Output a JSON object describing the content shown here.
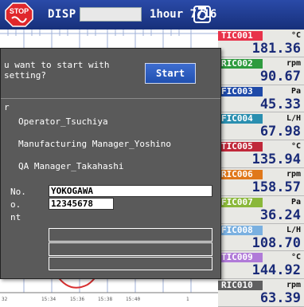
{
  "topbar": {
    "stop_icon": "stop-sign-icon",
    "disp_label": "DISP",
    "time_label": "1hour 7/16",
    "camera_icon": "camera-icon",
    "colors": {
      "bar": "#1f3a8f",
      "stop": "#e0282c"
    }
  },
  "trend": {
    "x_labels": [
      "32",
      "15:34",
      "15:36",
      "15:38",
      "15:40",
      "1"
    ]
  },
  "channels": [
    {
      "tag": "TIC001",
      "unit": "°C",
      "value": "181.36",
      "color": "#e8334a"
    },
    {
      "tag": "RIC002",
      "unit": "rpm",
      "value": "90.67",
      "color": "#2e9b3e"
    },
    {
      "tag": "FIC003",
      "unit": "Pa",
      "value": "45.33",
      "color": "#1f4aa8"
    },
    {
      "tag": "FIC004",
      "unit": "L/H",
      "value": "67.98",
      "color": "#2a8fb0"
    },
    {
      "tag": "TIC005",
      "unit": "°C",
      "value": "135.94",
      "color": "#c0283a"
    },
    {
      "tag": "RIC006",
      "unit": "rpm",
      "value": "158.57",
      "color": "#e0781a"
    },
    {
      "tag": "FIC007",
      "unit": "Pa",
      "value": "36.24",
      "color": "#8ab83a"
    },
    {
      "tag": "FIC008",
      "unit": "L/H",
      "value": "108.70",
      "color": "#7ab0e0"
    },
    {
      "tag": "TIC009",
      "unit": "°C",
      "value": "144.92",
      "color": "#b07ad8"
    },
    {
      "tag": "RIC010",
      "unit": "rpm",
      "value": "63.39",
      "color": "#606060"
    }
  ],
  "dialog": {
    "prompt": "u want to start with\nsetting?",
    "start_label": "Start",
    "frame_title": "r",
    "approvers": [
      "Operator_Tsuchiya",
      "Manufacturing Manager_Yoshino",
      "QA Manager_Takahashi"
    ],
    "fields": [
      {
        "label": "No.",
        "value": "YOKOGAWA"
      },
      {
        "label": "o.",
        "value": "12345678"
      }
    ],
    "comment_label": "nt",
    "comments": [
      "",
      "",
      ""
    ]
  }
}
